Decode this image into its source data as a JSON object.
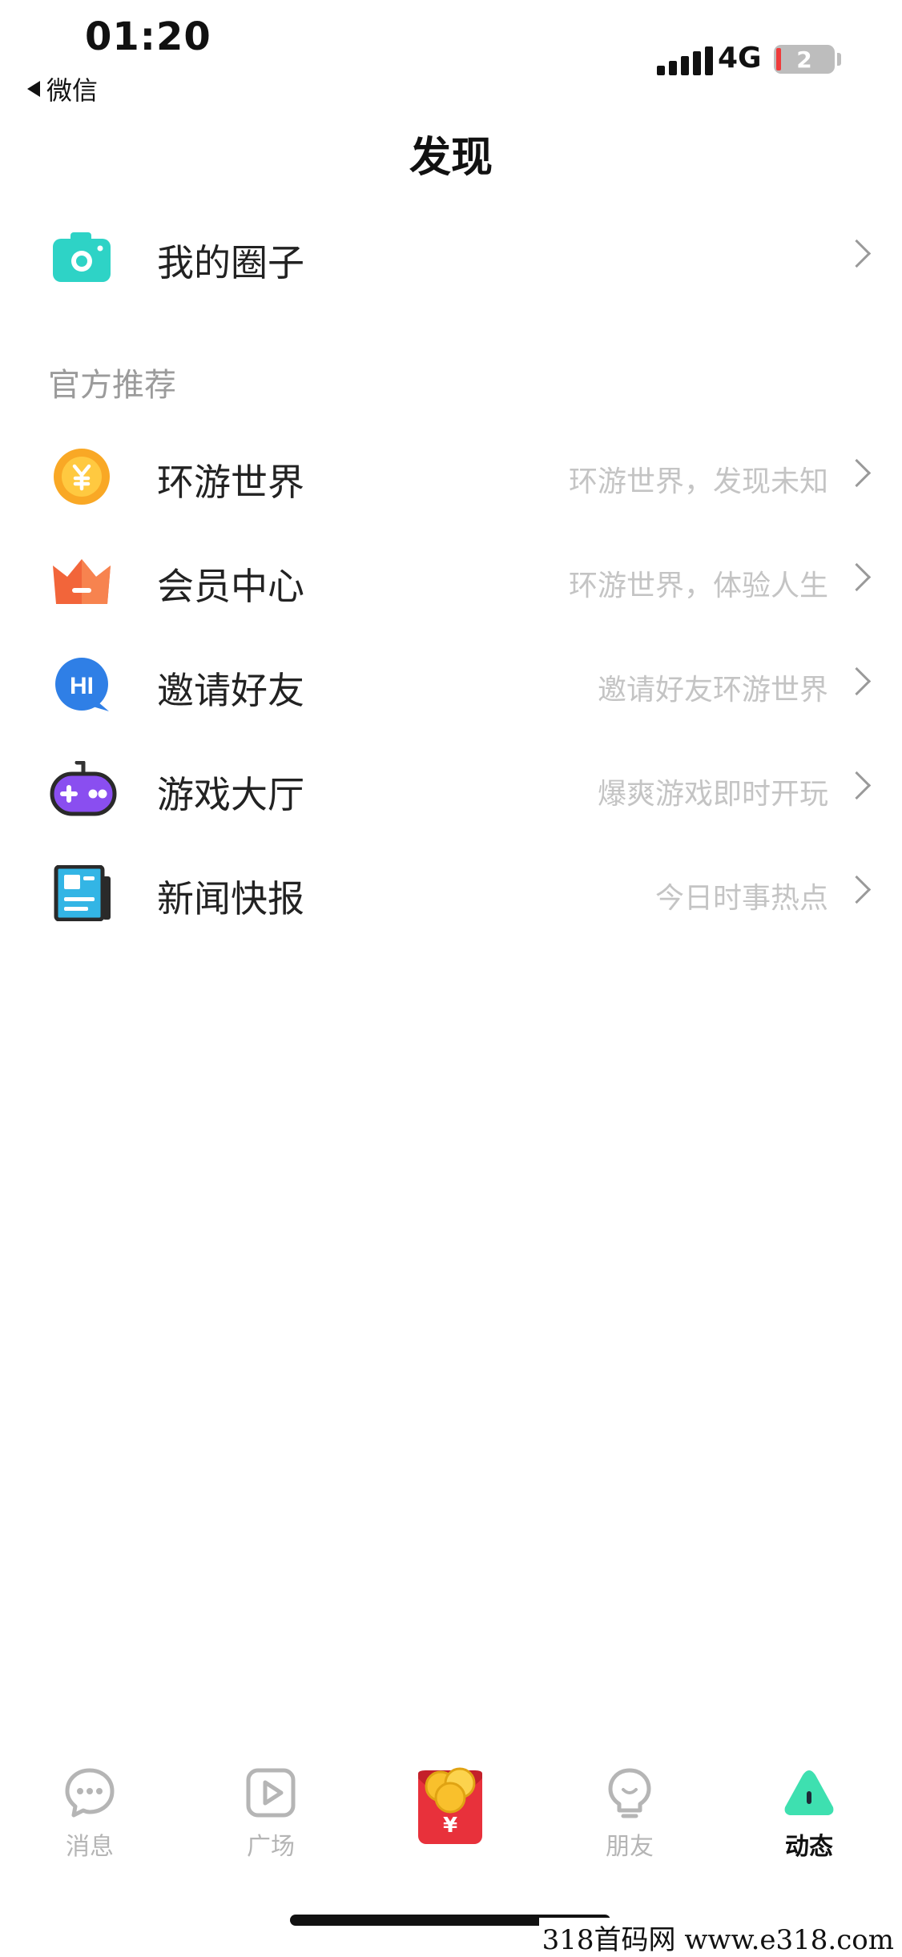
{
  "status_bar": {
    "time": "01:20",
    "back_app": "微信",
    "network": "4G",
    "battery_level": "2"
  },
  "page_title": "发现",
  "my_circle": {
    "label": "我的圈子"
  },
  "section_title": "官方推荐",
  "items": [
    {
      "label": "环游世界",
      "subtitle": "环游世界，发现未知",
      "icon": "coin-icon"
    },
    {
      "label": "会员中心",
      "subtitle": "环游世界，体验人生",
      "icon": "crown-icon"
    },
    {
      "label": "邀请好友",
      "subtitle": "邀请好友环游世界",
      "icon": "hi-bubble-icon"
    },
    {
      "label": "游戏大厅",
      "subtitle": "爆爽游戏即时开玩",
      "icon": "gamepad-icon"
    },
    {
      "label": "新闻快报",
      "subtitle": "今日时事热点",
      "icon": "newspaper-icon"
    }
  ],
  "tab_bar": {
    "messages": "消息",
    "plaza": "广场",
    "red_envelope_symbol": "¥",
    "friends": "朋友",
    "moments": "动态",
    "active": "动态"
  },
  "watermark": "318首码网  www.e318.com",
  "colors": {
    "teal": "#2ed3c6",
    "coin": "#f9a825",
    "crown": "#f2653a",
    "hi_blue": "#2f7fe6",
    "gamepad_purple": "#8a4ef0",
    "news_blue": "#33b5e5",
    "moments_green": "#3ee0b0",
    "red_envelope": "#e8313b"
  }
}
